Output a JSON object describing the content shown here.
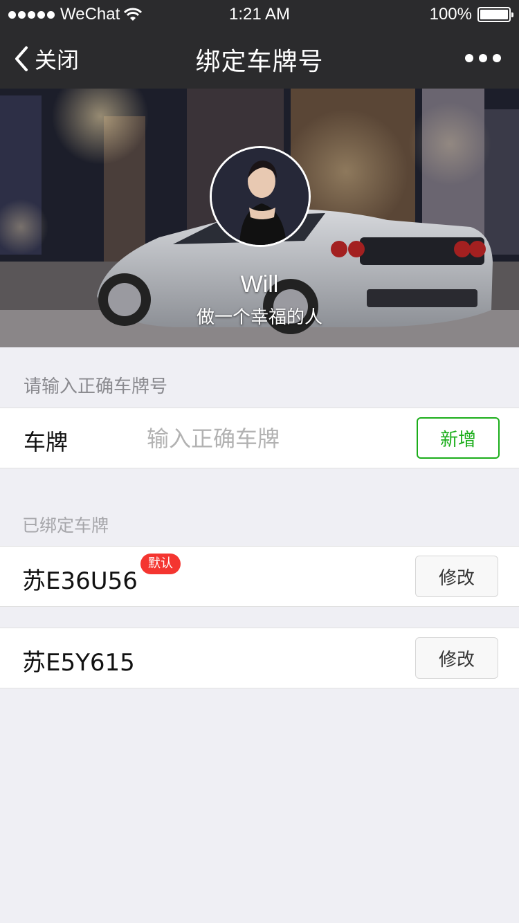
{
  "status_bar": {
    "carrier": "WeChat",
    "time": "1:21 AM",
    "battery": "100%"
  },
  "nav": {
    "back_label": "关闭",
    "title": "绑定车牌号",
    "icons": {
      "back": "chevron-left-icon",
      "more": "more-dots-icon"
    }
  },
  "profile": {
    "name": "Will",
    "motto": "做一个幸福的人"
  },
  "form": {
    "hint": "请输入正确车牌号",
    "label": "车牌",
    "placeholder": "输入正确车牌",
    "add_button": "新增"
  },
  "bound": {
    "title": "已绑定车牌",
    "plates": [
      {
        "number": "苏E36U56",
        "badge": "默认",
        "edit_label": "修改"
      },
      {
        "number": "苏E5Y615",
        "edit_label": "修改"
      }
    ]
  },
  "colors": {
    "nav_bg": "#2b2b2d",
    "accent_green": "#1aad19",
    "badge_red": "#f43530",
    "page_bg": "#efeff4"
  }
}
